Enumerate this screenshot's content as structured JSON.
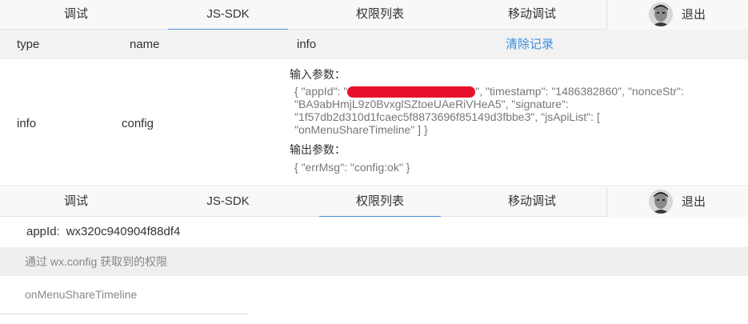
{
  "nav": {
    "tabs": [
      {
        "label": "调试"
      },
      {
        "label": "JS-SDK"
      },
      {
        "label": "权限列表"
      },
      {
        "label": "移动调试"
      }
    ],
    "logout_label": "退出",
    "accent_color": "#4a90d9"
  },
  "log_table": {
    "headers": {
      "type": "type",
      "name": "name",
      "info": "info"
    },
    "clear_label": "清除记录",
    "rows": [
      {
        "type": "info",
        "name": "config",
        "input_label": "输入参数：",
        "input_prefix": "{ \"appId\": \"",
        "input_suffix": "\", \"timestamp\": \"1486382860\", \"nonceStr\":",
        "input_line2": "\"BA9abHmjL9z0BvxglSZtoeUAeRiVHeA5\", \"signature\":",
        "input_line3": "\"1f57db2d310d1fcaec5f8873696f85149d3fbbe3\", \"jsApiList\": [",
        "input_line4": "\"onMenuShareTimeline\" ] }",
        "output_label": "输出参数：",
        "output_value": "{ \"errMsg\": \"config:ok\" }"
      }
    ]
  },
  "permissions": {
    "appid_label": "appId:",
    "appid_value": "wx320c940904f88df4",
    "section_header": "通过 wx.config 获取到的权限",
    "items": [
      "onMenuShareTimeline"
    ]
  }
}
